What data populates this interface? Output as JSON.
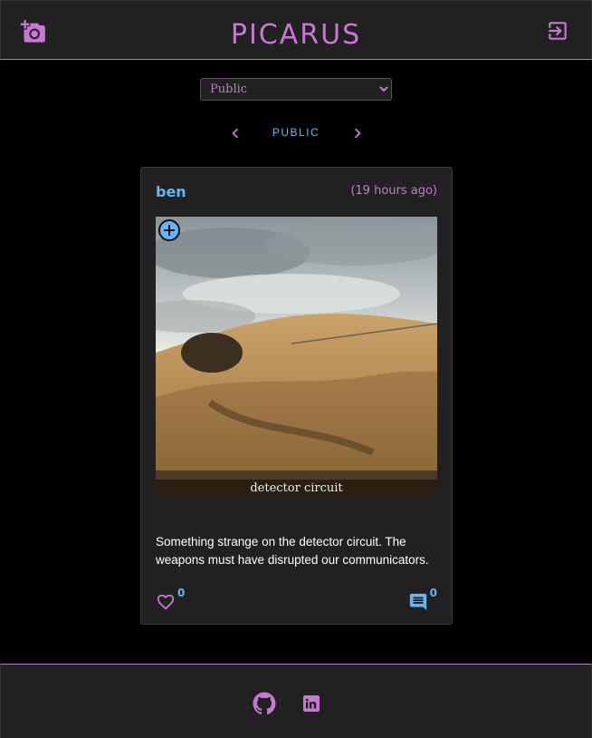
{
  "header": {
    "title": "PICARUS",
    "add_photo_icon": "add-a-photo-icon",
    "logout_icon": "logout-icon"
  },
  "filter": {
    "selected": "Public",
    "options": [
      "Public"
    ]
  },
  "pager": {
    "label": "PUBLIC",
    "prev_icon": "chevron-left-icon",
    "next_icon": "chevron-right-icon"
  },
  "post": {
    "author": "ben",
    "time_ago": "(19 hours ago)",
    "caption": "detector circuit",
    "description": "Something strange on the detector circuit. The weapons must have disrupted our communicators.",
    "likes": "0",
    "comments": "0"
  },
  "footer": {
    "github_icon": "github-icon",
    "linkedin_icon": "linkedin-icon"
  },
  "colors": {
    "accent": "#c878d4",
    "link": "#64b5f6",
    "surface": "#212121",
    "background": "#000000"
  }
}
